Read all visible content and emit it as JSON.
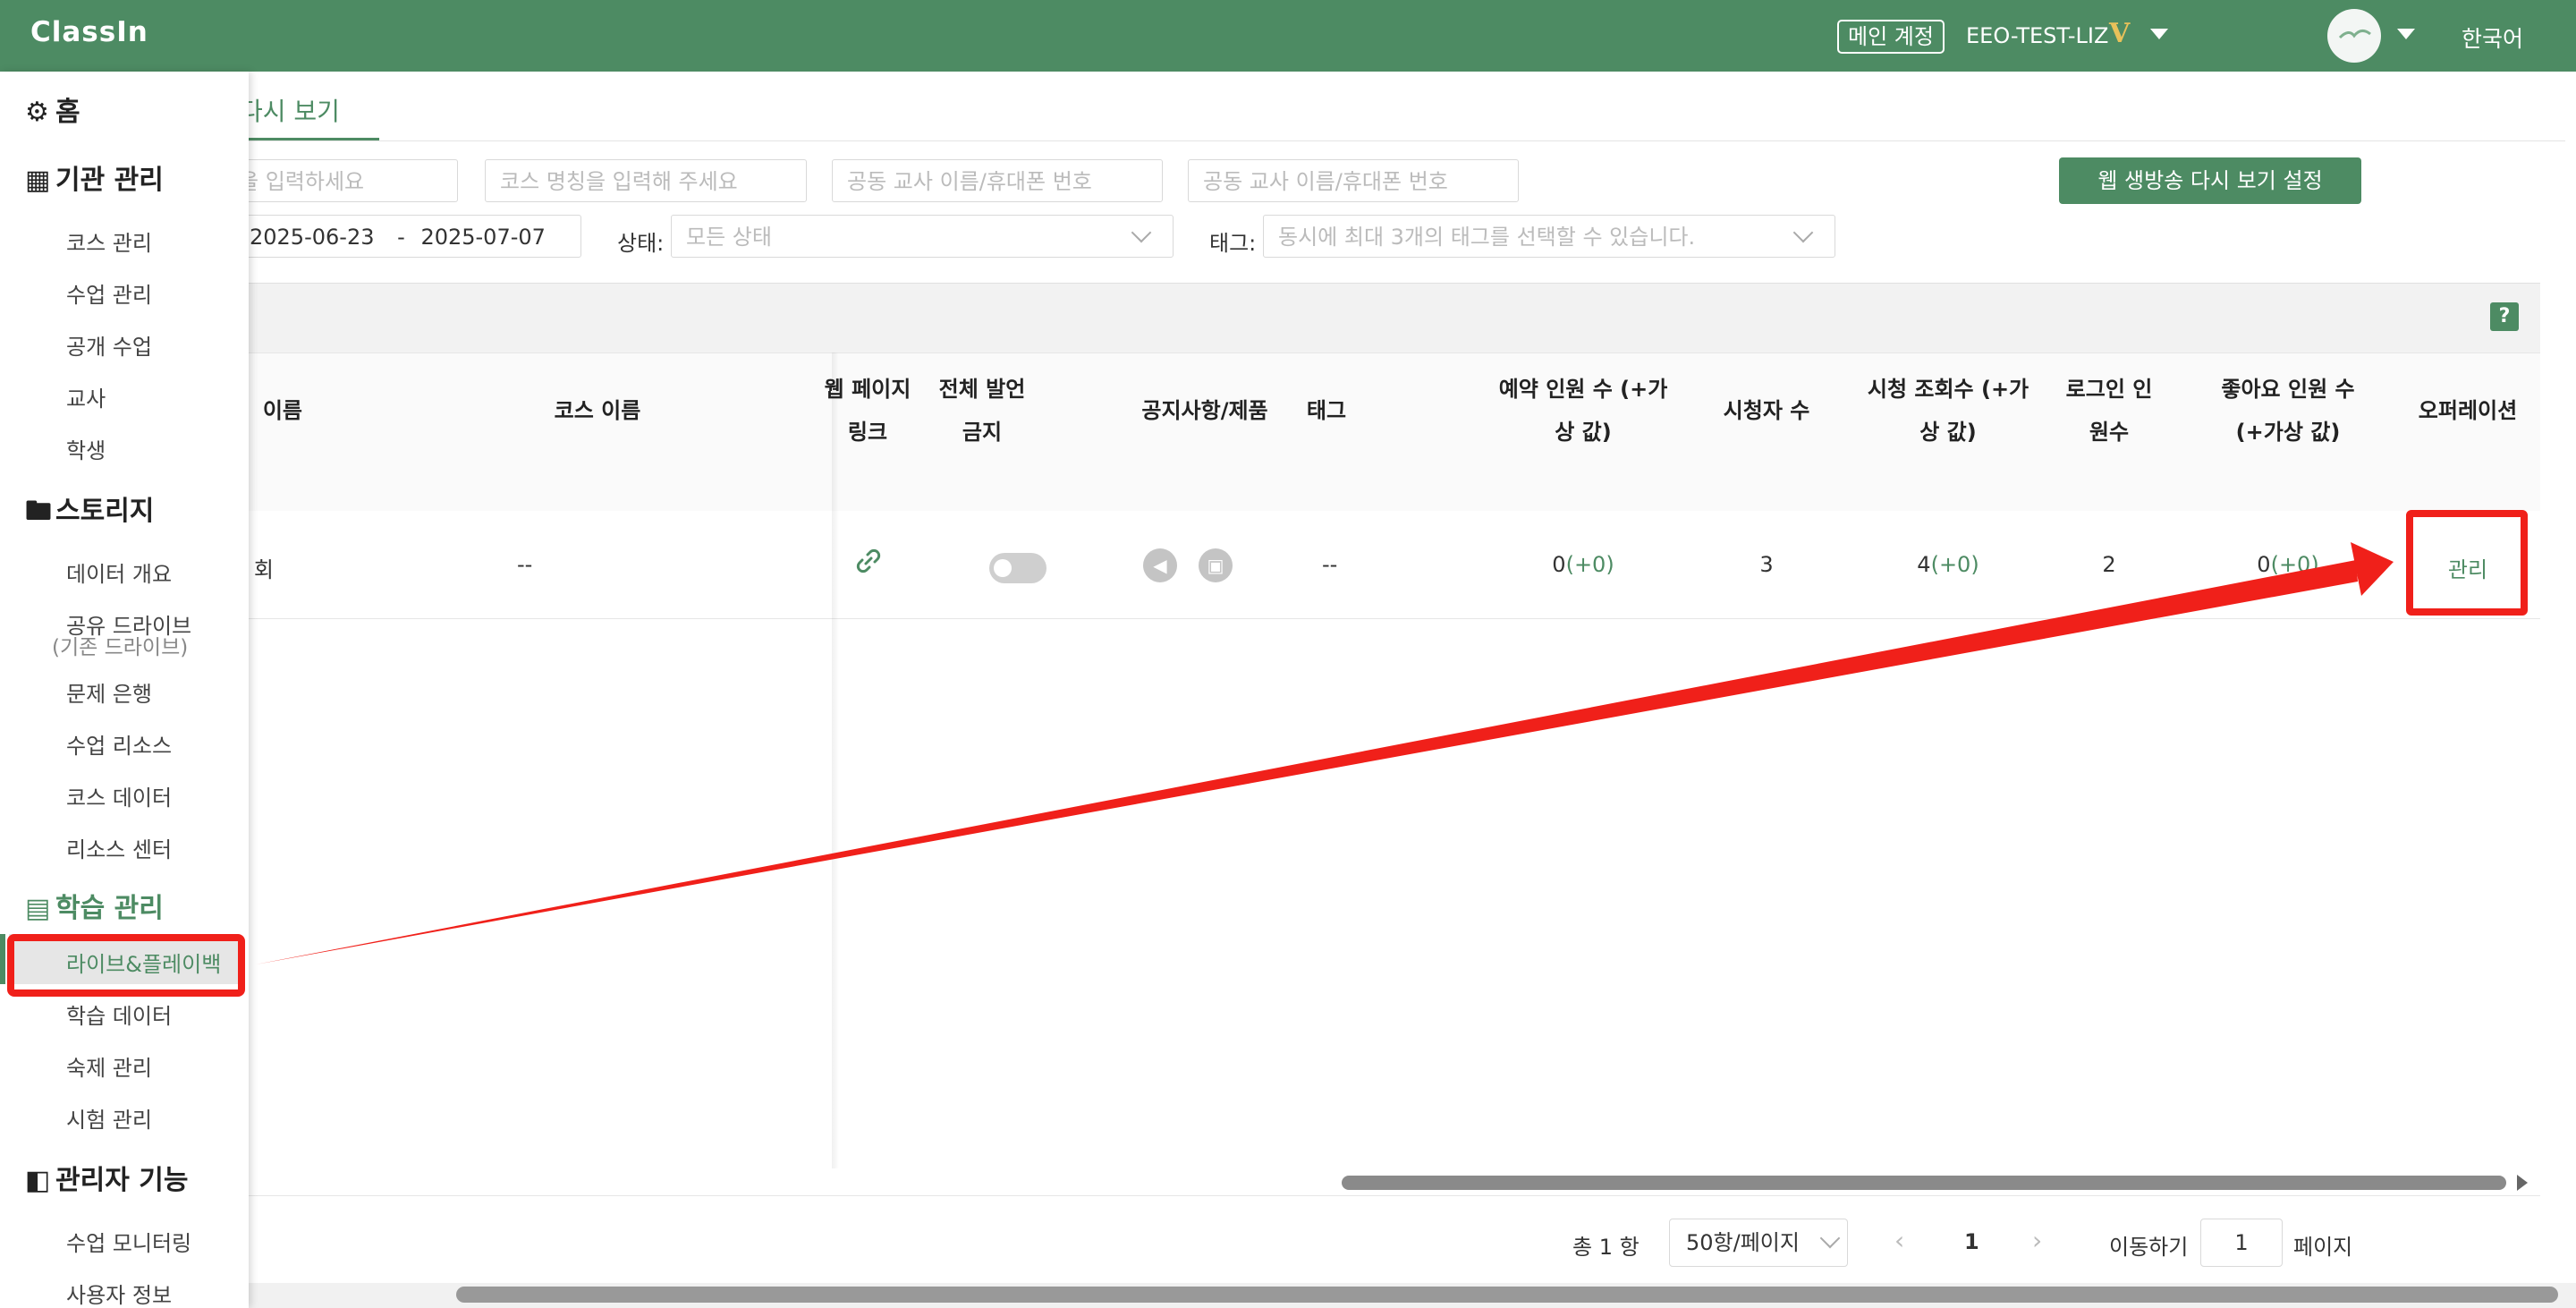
{
  "topbar": {
    "logo": "ClassIn",
    "account_badge": "메인 계정",
    "account_name": "EEO-TEST-LIZ",
    "vip_mark": "V",
    "language": "한국어"
  },
  "sidebar": {
    "sections": [
      {
        "label": "홈",
        "icon": "dashboard-icon"
      },
      {
        "label": "기관 관리",
        "icon": "calendar-icon"
      },
      {
        "label": "스토리지",
        "icon": "folder-icon"
      },
      {
        "label": "학습 관리",
        "icon": "learning-icon"
      },
      {
        "label": "관리자 기능",
        "icon": "admin-icon"
      }
    ],
    "institution_items": [
      "코스 관리",
      "수업 관리",
      "공개 수업",
      "교사",
      "학생"
    ],
    "storage_items": [
      "데이터 개요",
      "공유 드라이브",
      "(기존 드라이브)",
      "문제 은행",
      "수업 리소스",
      "코스 데이터",
      "리소스 센터"
    ],
    "learning_items": [
      "라이브&플레이백",
      "학습 데이터",
      "숙제 관리",
      "시험 관리"
    ],
    "admin_items": [
      "수업 모니터링",
      "사용자 정보"
    ]
  },
  "main": {
    "tab_label": "다시 보기",
    "filters": {
      "name_placeholder": "을 입력하세요",
      "course_placeholder": "코스 명칭을 입력해 주세요",
      "coteacher_placeholder_1": "공동 교사 이름/휴대폰 번호",
      "coteacher_placeholder_2": "공동 교사 이름/휴대폰 번호",
      "date_start": "2025-06-23",
      "date_sep": "-",
      "date_end": "2025-07-07",
      "status_label": "상태:",
      "status_value": "모든 상태",
      "tag_label": "태그:",
      "tag_placeholder": "동시에 최대 3개의 태그를 선택할 수 있습니다."
    },
    "settings_button": "웹 생방송 다시 보기 설정",
    "help_icon_text": "?",
    "columns": [
      {
        "line1": "이름",
        "line2": ""
      },
      {
        "line1": "코스 이름",
        "line2": ""
      },
      {
        "line1": "웹 페이지",
        "line2": "링크"
      },
      {
        "line1": "전체 발언",
        "line2": "금지"
      },
      {
        "line1": "공지사항/제품",
        "line2": ""
      },
      {
        "line1": "태그",
        "line2": ""
      },
      {
        "line1": "예약 인원 수 (+가",
        "line2": "상 값)"
      },
      {
        "line1": "시청자 수",
        "line2": ""
      },
      {
        "line1": "시청 조회수 (+가",
        "line2": "상 값)"
      },
      {
        "line1": "로그인 인",
        "line2": "원수"
      },
      {
        "line1": "좋아요 인원 수",
        "line2": "(+가상 값)"
      },
      {
        "line1": "오퍼레이션",
        "line2": ""
      }
    ],
    "row": {
      "name": "회",
      "course_name": "--",
      "tag": "--",
      "reservations": "0",
      "reservations_extra": "(+0)",
      "viewers": "3",
      "views": "4",
      "views_extra": "(+0)",
      "logins": "2",
      "likes": "0",
      "likes_extra": "(+0)",
      "operation": "관리"
    },
    "pagination": {
      "total": "총 1 항",
      "page_size": "50항/페이지",
      "current_page": "1",
      "goto_label": "이동하기",
      "goto_value": "1",
      "page_suffix": "페이지"
    }
  },
  "colors": {
    "brand": "#4d8b63",
    "annotation": "#f0201a"
  }
}
